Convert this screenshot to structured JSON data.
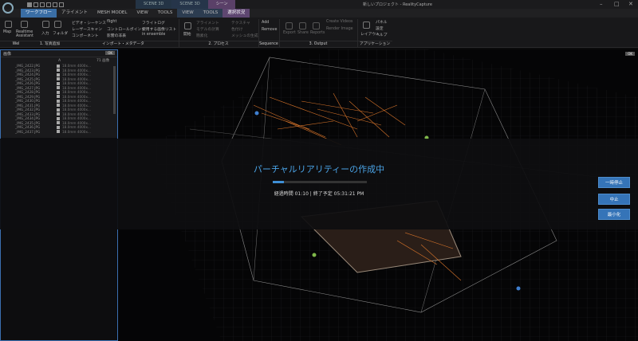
{
  "titlebar": {
    "tabs": [
      "SCENE 3D",
      "SCENE 3D",
      "シーン"
    ],
    "title": "新しいプロジェクト - RealityCapture"
  },
  "menu": {
    "tabs": [
      "ワークフロー",
      "アライメント",
      "MESH MODEL",
      "VIEW",
      "TOOLS",
      "VIEW",
      "TOOLS",
      "選択状況"
    ]
  },
  "ribbon": {
    "input": {
      "items": [
        "Map",
        "Realtime\nAssistant",
        "入力",
        "フォルダ",
        "ビデオ・シーケンス",
        "レーザースキャン",
        "コンポーネント",
        "flight"
      ],
      "group_labels": [
        "Wel",
        "1. 写真追加",
        "インポート・メタデータ"
      ]
    },
    "import_items": [
      "フライトログ",
      "コントロールポイント",
      "使用する画像リスト",
      "影響の非表",
      "in ensemble"
    ],
    "process": {
      "start": "開始",
      "items": [
        "アライメント",
        "モデルの計算",
        "簡素化",
        "テクスチャ",
        "色付け",
        "メッシュの生成"
      ],
      "group_label": "2. プロセス"
    },
    "sequence": {
      "items": [
        "Add",
        "Remove"
      ],
      "group_label": "Sequence"
    },
    "output": {
      "items": [
        "Export",
        "Share",
        "Reports",
        "Create Videos",
        "Render Image"
      ],
      "group_label": "3. Output"
    },
    "app": {
      "items": [
        "レイアウト",
        "パネル",
        "設定",
        "ヘルプ"
      ],
      "group_label": "アプリケーション"
    }
  },
  "left_panel": {
    "header": "画像",
    "ok": "OK",
    "col_a": "A",
    "col_count": "71 画像",
    "files": [
      "_IMG_2422.JPG",
      "_IMG_2423.JPG",
      "_IMG_2424.JPG",
      "_IMG_2425.JPG",
      "_IMG_2426.JPG",
      "_IMG_2427.JPG",
      "_IMG_2428.JPG",
      "_IMG_2429.JPG",
      "_IMG_2430.JPG",
      "_IMG_2431.JPG",
      "_IMG_2432.JPG",
      "_IMG_2433.JPG",
      "_IMG_2434.JPG",
      "_IMG_2435.JPG",
      "_IMG_2436.JPG",
      "_IMG_2437.JPG"
    ],
    "row_info": "18.0mm 4000x..."
  },
  "viewport": {
    "ok": "OK"
  },
  "progress": {
    "title": "パーチャルリアリティーの作成中",
    "status": "経過時間 01:10 | 終了予定 05:31:21 PM",
    "fraction": 0.12
  },
  "buttons": {
    "pause": "一時停止",
    "stop": "中止",
    "minimize": "最小化"
  },
  "colors": {
    "accent": "#3574b8",
    "title_blue": "#4aa3e6",
    "camera_orange": "#d8742a",
    "selection_purple": "#5e4670"
  }
}
